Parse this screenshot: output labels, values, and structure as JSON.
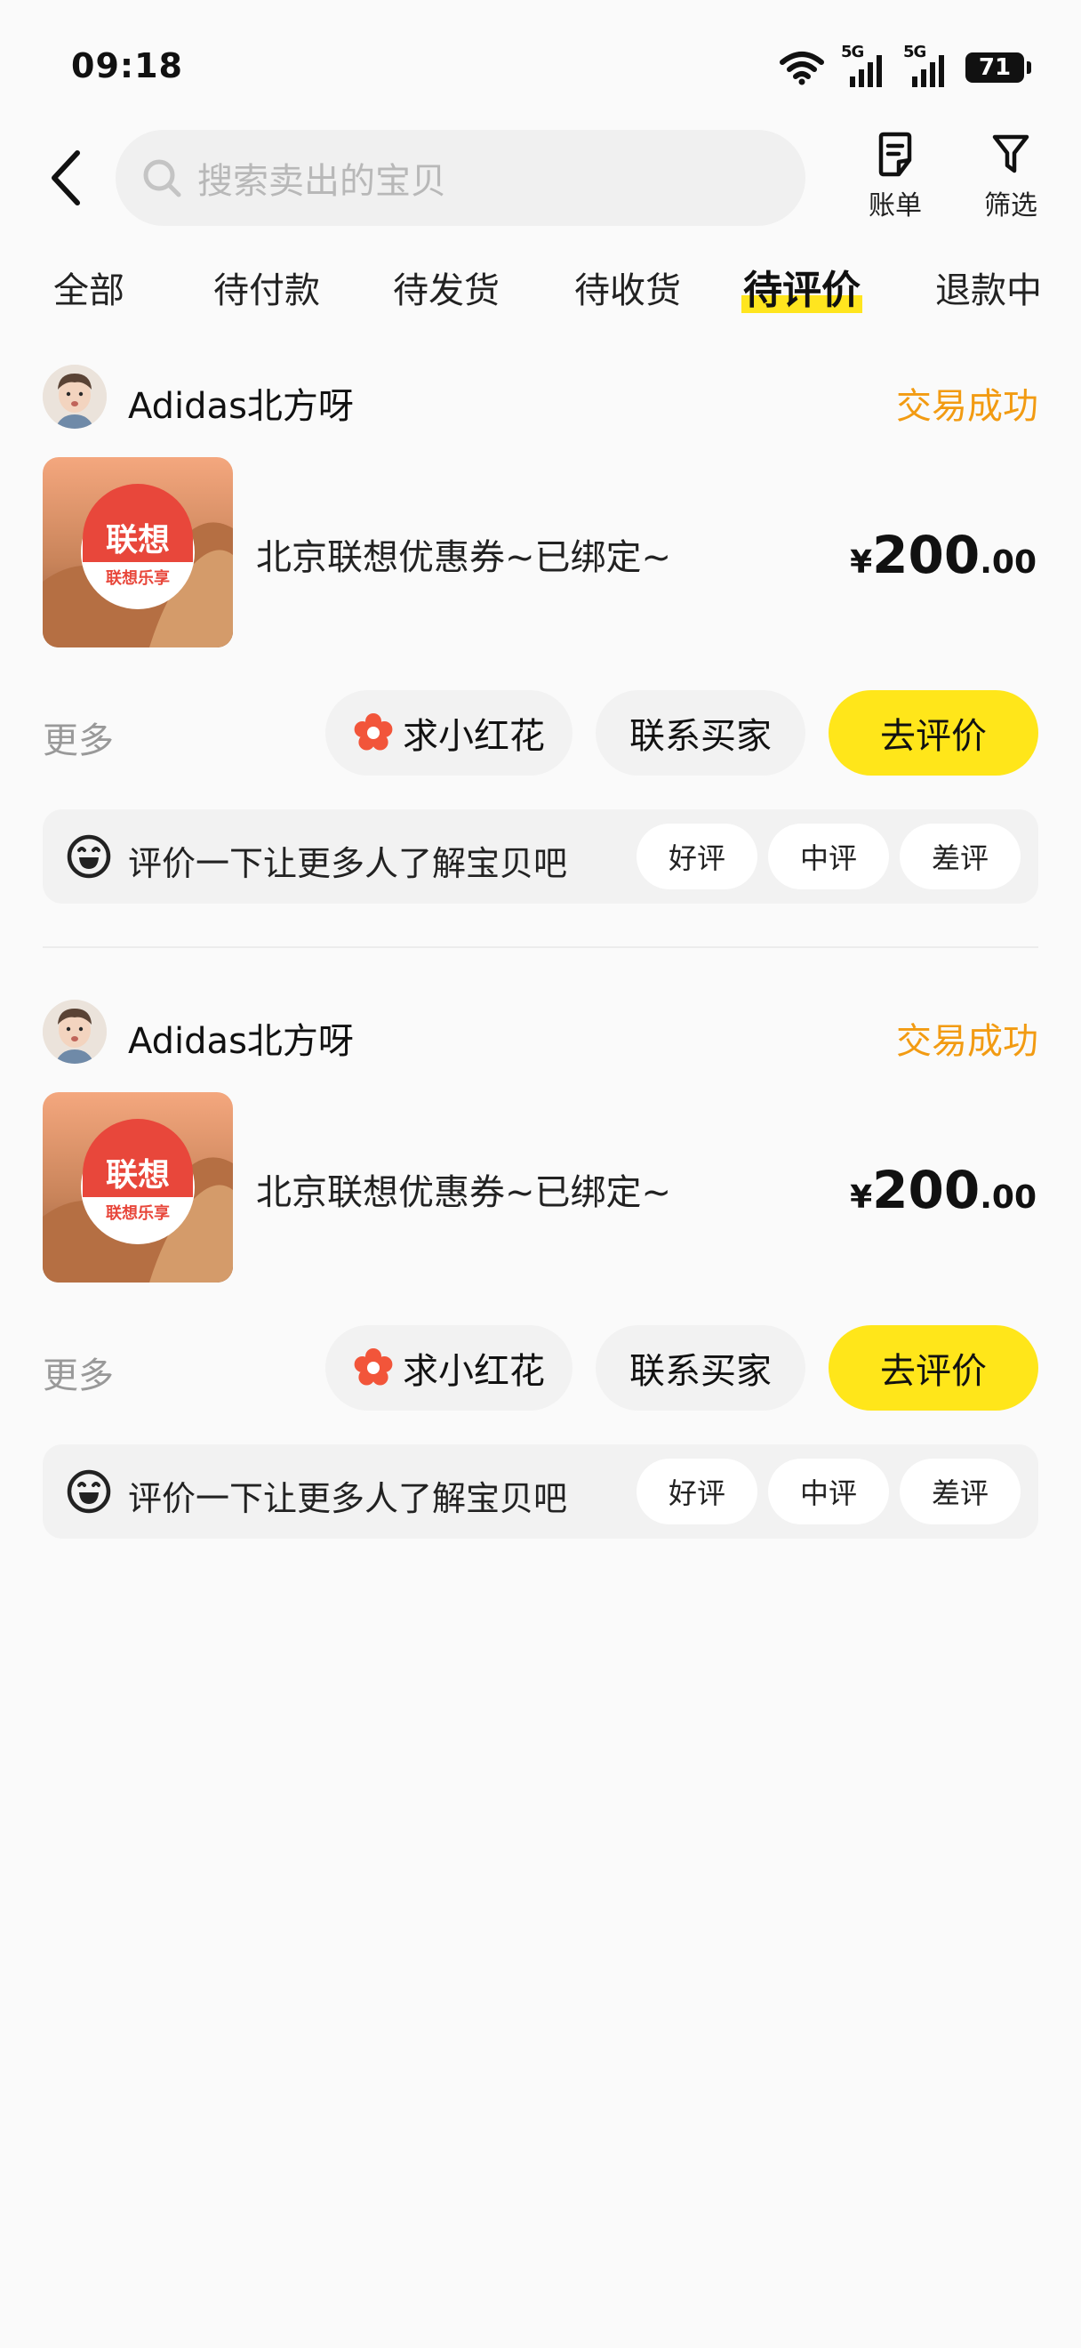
{
  "status_bar": {
    "time": "09:18",
    "network_label": "5G",
    "battery": "71"
  },
  "header": {
    "search_placeholder": "搜索卖出的宝贝",
    "bill_label": "账单",
    "filter_label": "筛选"
  },
  "tabs": [
    {
      "label": "全部"
    },
    {
      "label": "待付款"
    },
    {
      "label": "待发货"
    },
    {
      "label": "待收货"
    },
    {
      "label": "待评价",
      "active": true
    },
    {
      "label": "退款中"
    }
  ],
  "orders": [
    {
      "seller_name": "Adidas北方呀",
      "status": "交易成功",
      "product_title": "北京联想优惠券~已绑定~",
      "thumb_text_main": "联想",
      "thumb_text_sub": "联想乐享",
      "price_symbol": "¥",
      "price_int": "200",
      "price_dec": ".00",
      "more_label": "更多",
      "flower_button": "求小红花",
      "contact_button": "联系买家",
      "review_button": "去评价",
      "review_prompt": "评价一下让更多人了解宝贝吧",
      "ratings": [
        "好评",
        "中评",
        "差评"
      ]
    },
    {
      "seller_name": "Adidas北方呀",
      "status": "交易成功",
      "product_title": "北京联想优惠券~已绑定~",
      "thumb_text_main": "联想",
      "thumb_text_sub": "联想乐享",
      "price_symbol": "¥",
      "price_int": "200",
      "price_dec": ".00",
      "more_label": "更多",
      "flower_button": "求小红花",
      "contact_button": "联系买家",
      "review_button": "去评价",
      "review_prompt": "评价一下让更多人了解宝贝吧",
      "ratings": [
        "好评",
        "中评",
        "差评"
      ]
    }
  ],
  "colors": {
    "accent_yellow": "#ffe61a",
    "status_orange": "#f29b12",
    "flower_red": "#f2553a"
  },
  "icons": [
    "back-arrow-icon",
    "search-icon",
    "bill-icon",
    "filter-icon",
    "flower-icon",
    "smile-icon",
    "wifi-icon",
    "signal-icon",
    "battery-icon"
  ]
}
